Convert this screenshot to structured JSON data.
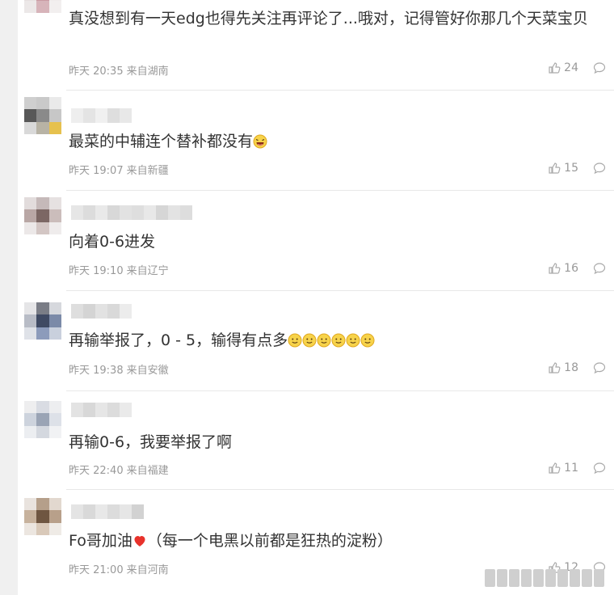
{
  "comments": [
    {
      "text": "真没想到有一天edg也得先关注再评论了...哦对，记得管好你那几个天菜宝贝",
      "time": "昨天 20:35",
      "location": "来自湖南",
      "likes": "24"
    },
    {
      "text": "最菜的中辅连个替补都没有",
      "emoji": "laughing-face",
      "time": "昨天 19:07",
      "location": "来自新疆",
      "likes": "15"
    },
    {
      "text": "向着0-6进发",
      "time": "昨天 19:10",
      "location": "来自辽宁",
      "likes": "16"
    },
    {
      "text": "再输举报了，0 - 5，输得有点多",
      "emoji": "smile-face",
      "emoji_count": 6,
      "time": "昨天 19:38",
      "location": "来自安徽",
      "likes": "18"
    },
    {
      "text": "再输0-6，我要举报了啊",
      "time": "昨天 22:40",
      "location": "来自福建",
      "likes": "11"
    },
    {
      "text": "Fo哥加油",
      "emoji": "red-heart",
      "text_after": "（每一个电黑以前都是狂热的淀粉）",
      "time": "昨天 21:00",
      "location": "来自河南",
      "likes": "12"
    }
  ],
  "colors": {
    "text": "#333333",
    "meta": "#999999",
    "divider": "#e8e8e8",
    "emoji_yellow": "#f7d34a",
    "heart_red": "#e8322b"
  }
}
